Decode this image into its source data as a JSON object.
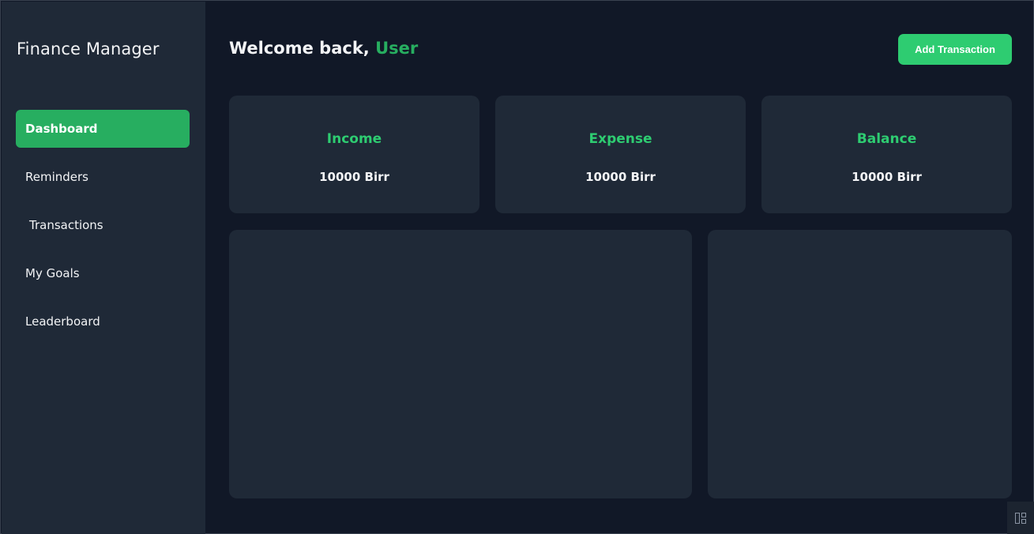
{
  "app": {
    "title": "Finance Manager"
  },
  "sidebar": {
    "items": [
      {
        "label": "Dashboard",
        "active": true
      },
      {
        "label": "Reminders",
        "active": false
      },
      {
        "label": "Transactions",
        "active": false
      },
      {
        "label": "My Goals",
        "active": false
      },
      {
        "label": "Leaderboard",
        "active": false
      }
    ]
  },
  "header": {
    "welcome_prefix": "Welcome back,",
    "username": "User",
    "add_button_label": "Add Transaction"
  },
  "stats": [
    {
      "label": "Income",
      "value": "10000 Birr"
    },
    {
      "label": "Expense",
      "value": "10000 Birr"
    },
    {
      "label": "Balance",
      "value": "10000 Birr"
    }
  ],
  "colors": {
    "accent": "#2ecc71",
    "accent_dark": "#27ae60",
    "background": "#111827",
    "panel": "#1f2937"
  },
  "icons": {
    "corner_widget": "layout-icon"
  }
}
